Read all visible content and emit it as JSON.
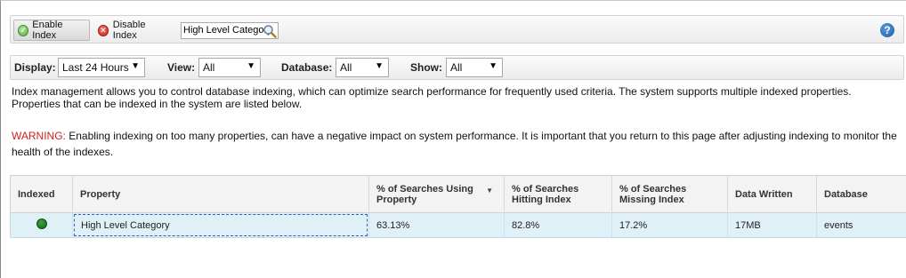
{
  "toolbar": {
    "enable_label": "Enable Index",
    "disable_label": "Disable Index",
    "search_value": "High Level Category",
    "help_label": "?"
  },
  "filters": {
    "display_label": "Display:",
    "display_value": "Last 24 Hours",
    "view_label": "View:",
    "view_value": "All",
    "database_label": "Database:",
    "database_value": "All",
    "show_label": "Show:",
    "show_value": "All"
  },
  "description": "Index management allows you to control database indexing, which can optimize search performance for frequently used criteria. The system supports multiple indexed properties. Properties that can be indexed in the system are listed below.",
  "warning": {
    "label": "WARNING:",
    "text": " Enabling indexing on too many properties, can have a negative impact on system performance. It is important that you return to this page after adjusting indexing to monitor the health of the indexes."
  },
  "table": {
    "headers": {
      "indexed": "Indexed",
      "property": "Property",
      "pct_using": "% of Searches Using Property",
      "pct_hitting": "% of Searches Hitting Index",
      "pct_missing": "% of Searches Missing Index",
      "data_written": "Data Written",
      "database": "Database"
    },
    "rows": [
      {
        "indexed": "enabled",
        "property": "High Level Category",
        "pct_using": "63.13%",
        "pct_hitting": "82.8%",
        "pct_missing": "17.2%",
        "data_written": "17MB",
        "database": "events"
      }
    ]
  },
  "colors": {
    "warning": "#d21f1f",
    "row_selected": "#dff0f7",
    "indexed_dot": "#1a7d1f"
  }
}
